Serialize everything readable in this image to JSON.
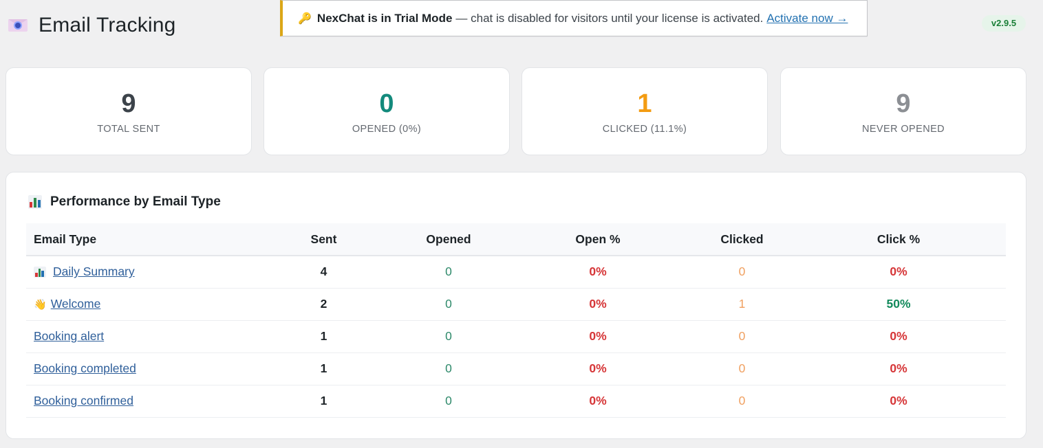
{
  "header": {
    "title": "Email Tracking",
    "version": "v2.9.5"
  },
  "notice": {
    "strong": "NexChat is in Trial Mode",
    "text": "— chat is disabled for visitors until your license is activated.",
    "link": "Activate now →",
    "accent": "#dba617"
  },
  "stats": [
    {
      "value": "9",
      "label": "TOTAL SENT",
      "color": "#3c434a"
    },
    {
      "value": "0",
      "label": "OPENED (0%)",
      "color": "#138a7c"
    },
    {
      "value": "1",
      "label": "CLICKED (11.1%)",
      "color": "#f39c12"
    },
    {
      "value": "9",
      "label": "NEVER OPENED",
      "color": "#8c8f94"
    }
  ],
  "panel": {
    "title": "Performance by Email Type",
    "columns": [
      "Email Type",
      "Sent",
      "Opened",
      "Open %",
      "Clicked",
      "Click %"
    ],
    "rows": [
      {
        "icon": "bar-chart-icon",
        "type": "Daily Summary",
        "sent": "4",
        "opened": "0",
        "open_pct": "0%",
        "clicked": "0",
        "click_pct": "0%",
        "click_pct_color": "#d63638"
      },
      {
        "icon": "waving-hand-icon",
        "type": "Welcome",
        "sent": "2",
        "opened": "0",
        "open_pct": "0%",
        "clicked": "1",
        "click_pct": "50%",
        "click_pct_color": "#138a5c"
      },
      {
        "icon": "",
        "type": "Booking alert",
        "sent": "1",
        "opened": "0",
        "open_pct": "0%",
        "clicked": "0",
        "click_pct": "0%",
        "click_pct_color": "#d63638"
      },
      {
        "icon": "",
        "type": "Booking completed",
        "sent": "1",
        "opened": "0",
        "open_pct": "0%",
        "clicked": "0",
        "click_pct": "0%",
        "click_pct_color": "#d63638"
      },
      {
        "icon": "",
        "type": "Booking confirmed",
        "sent": "1",
        "opened": "0",
        "open_pct": "0%",
        "clicked": "0",
        "click_pct": "0%",
        "click_pct_color": "#d63638"
      }
    ]
  }
}
